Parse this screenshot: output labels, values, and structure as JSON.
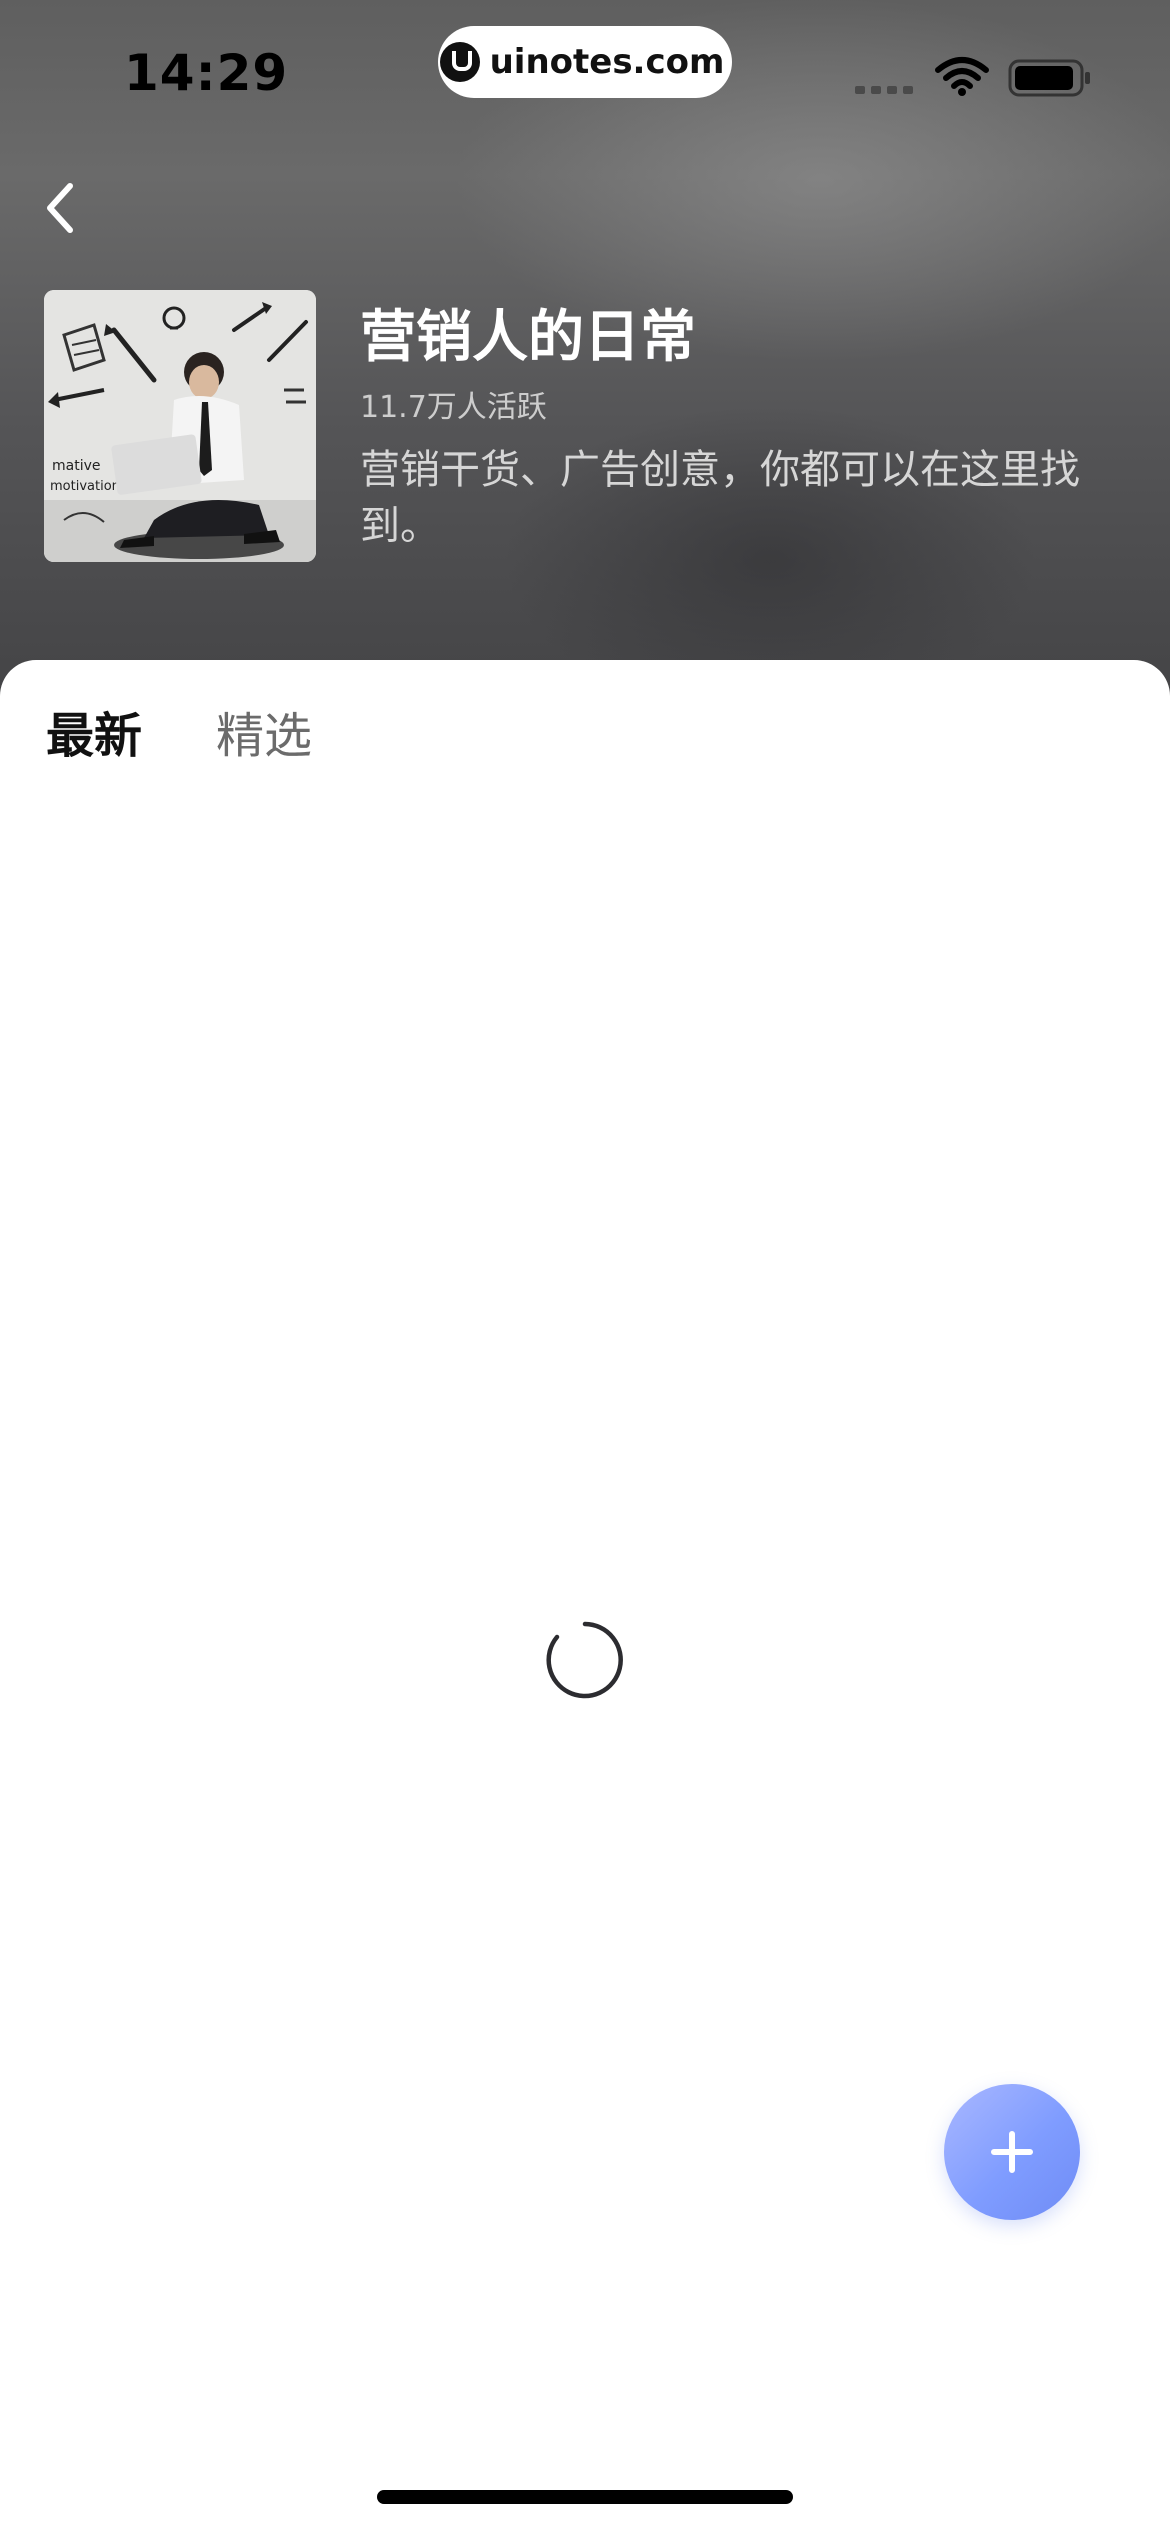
{
  "status_bar": {
    "time": "14:29",
    "watermark": "uinotes.com",
    "icons": [
      "signal-dots-icon",
      "wifi-icon",
      "battery-icon"
    ]
  },
  "header": {
    "back_icon": "chevron-left-icon",
    "cover_image": "man-with-laptop-illustration",
    "title": "营销人的日常",
    "active_count": "11.7万人活跃",
    "description": "营销干货、广告创意，你都可以在这里找到。"
  },
  "tabs": [
    {
      "label": "最新",
      "selected": true
    },
    {
      "label": "精选",
      "selected": false
    }
  ],
  "content": {
    "loading_icon": "loading-spinner-icon"
  },
  "fab": {
    "icon": "plus-icon",
    "color": "#7f9cff"
  },
  "colors": {
    "header_bg": "#5f5f5f",
    "accent": "#7f9cff",
    "tab_active": "#111111",
    "tab_inactive": "#6b6b6b"
  }
}
